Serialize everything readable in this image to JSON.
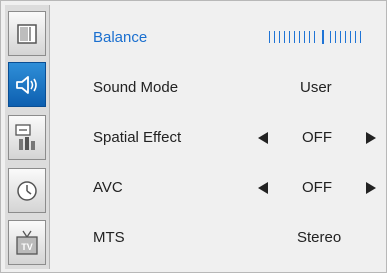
{
  "sidebar": {
    "tabs": [
      {
        "icon": "picture-icon",
        "active": false
      },
      {
        "icon": "speaker-icon",
        "active": true
      },
      {
        "icon": "setup-icon",
        "active": false
      },
      {
        "icon": "clock-icon",
        "active": false
      },
      {
        "icon": "tv-icon",
        "active": false
      }
    ]
  },
  "menu": {
    "items": [
      {
        "label": "Balance",
        "balance_level": 0.5
      },
      {
        "label": "Sound Mode",
        "value": "User"
      },
      {
        "label": "Spatial Effect",
        "value": "OFF"
      },
      {
        "label": "AVC",
        "value": "OFF"
      },
      {
        "label": "MTS",
        "value": "Stereo"
      }
    ]
  },
  "colors": {
    "accent": "#1a6fcf",
    "active_tab": "#0d5fb0",
    "panel": "#f0f0f0"
  }
}
